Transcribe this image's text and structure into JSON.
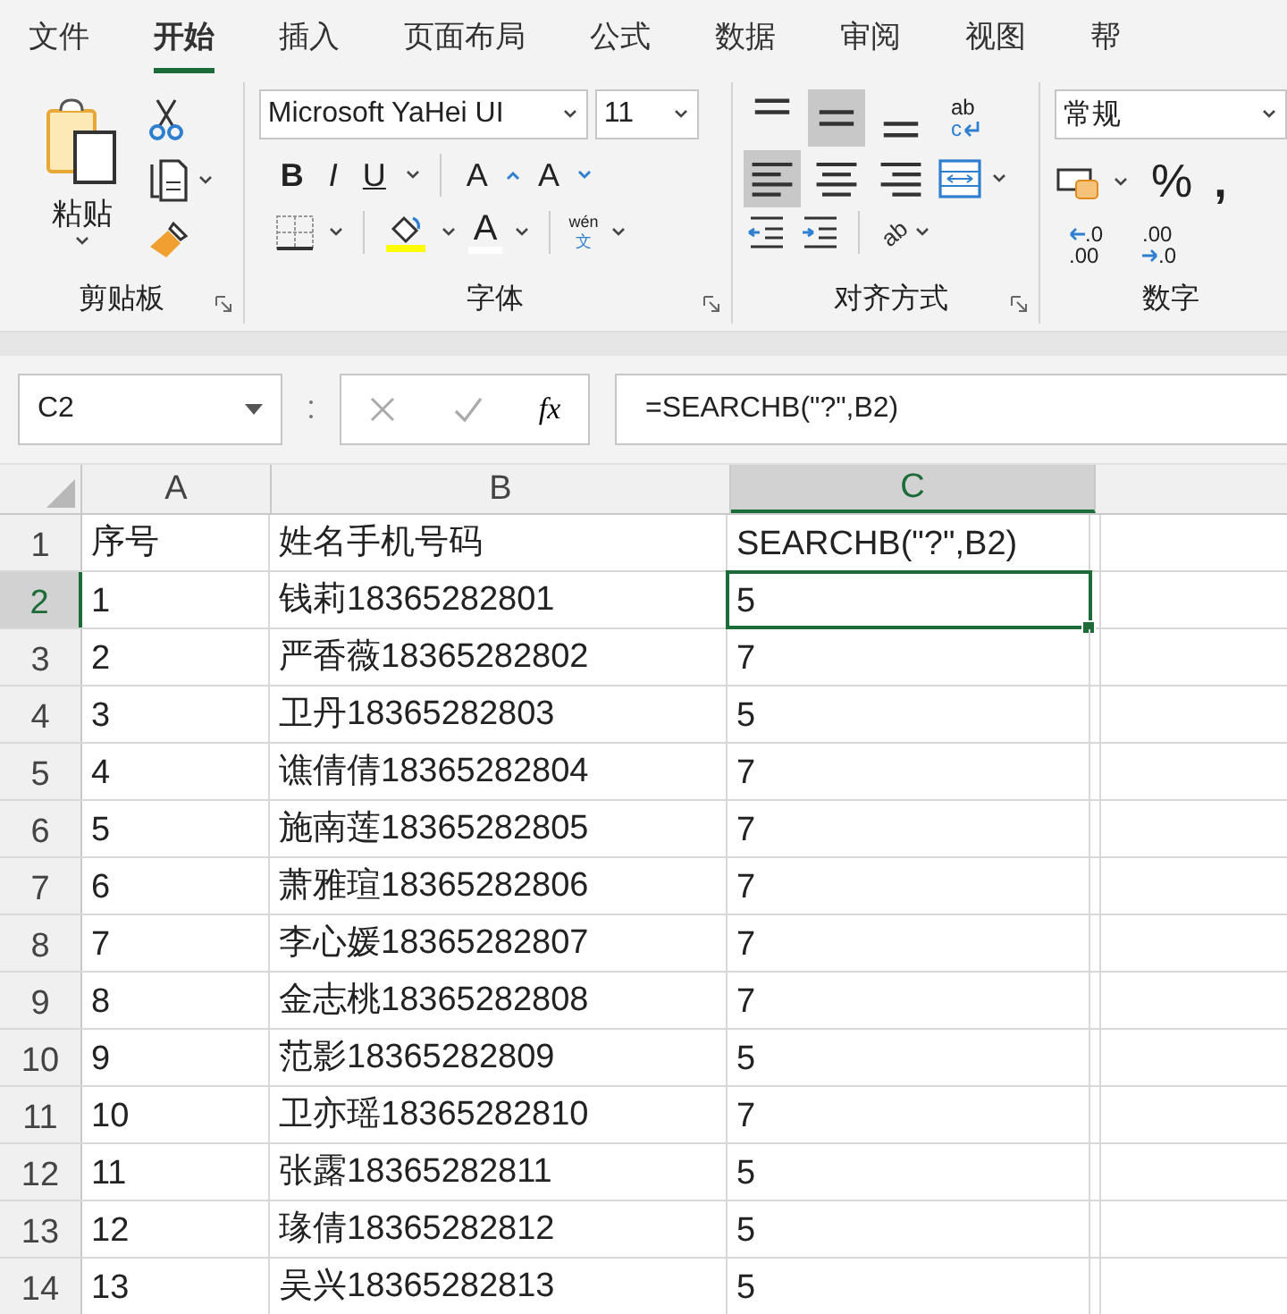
{
  "ribbon_tabs": [
    {
      "label": "文件",
      "selected": false
    },
    {
      "label": "开始",
      "selected": true
    },
    {
      "label": "插入",
      "selected": false
    },
    {
      "label": "页面布局",
      "selected": false
    },
    {
      "label": "公式",
      "selected": false
    },
    {
      "label": "数据",
      "selected": false
    },
    {
      "label": "审阅",
      "selected": false
    },
    {
      "label": "视图",
      "selected": false
    },
    {
      "label": "帮",
      "selected": false
    }
  ],
  "clipboard": {
    "paste_label": "粘贴",
    "group_label": "剪贴板"
  },
  "font": {
    "family": "Microsoft YaHei UI",
    "size": "11",
    "bold": "B",
    "italic": "I",
    "underline": "U",
    "grow": "A",
    "shrink": "A",
    "font_color": "A",
    "phonetic_top": "wén",
    "phonetic_bottom": "文",
    "group_label": "字体"
  },
  "alignment": {
    "vertical": [
      {
        "kind": "top",
        "selected": false
      },
      {
        "kind": "middle",
        "selected": true
      },
      {
        "kind": "bottom",
        "selected": false
      }
    ],
    "horizontal": [
      {
        "kind": "left",
        "selected": true
      },
      {
        "kind": "center",
        "selected": false
      },
      {
        "kind": "right",
        "selected": false
      }
    ],
    "wrap_top": "ab",
    "wrap_bottom": "c",
    "orientation": "ab",
    "group_label": "对齐方式"
  },
  "number": {
    "format": "常规",
    "percent": "%",
    "comma": ",",
    "increase_decimal": [
      ".0",
      ".00"
    ],
    "decrease_decimal": [
      ".00",
      ".0"
    ],
    "group_label": "数字"
  },
  "formula_bar": {
    "name_box": "C2",
    "fx": "fx",
    "formula": "=SEARCHB(\"?\",B2)"
  },
  "columns": [
    {
      "label": "A",
      "selected": false
    },
    {
      "label": "B",
      "selected": false
    },
    {
      "label": "C",
      "selected": true
    }
  ],
  "rows": [
    {
      "number": "1",
      "selected": false,
      "cells": [
        {
          "text": "序号",
          "selected": false
        },
        {
          "text": "姓名手机号码",
          "selected": false
        },
        {
          "text": "SEARCHB(\"?\",B2)",
          "selected": false
        }
      ]
    },
    {
      "number": "2",
      "selected": true,
      "cells": [
        {
          "text": "1",
          "selected": false
        },
        {
          "text": "钱莉18365282801",
          "selected": false
        },
        {
          "text": "5",
          "selected": true
        }
      ]
    },
    {
      "number": "3",
      "selected": false,
      "cells": [
        {
          "text": "2",
          "selected": false
        },
        {
          "text": "严香薇18365282802",
          "selected": false
        },
        {
          "text": "7",
          "selected": false
        }
      ]
    },
    {
      "number": "4",
      "selected": false,
      "cells": [
        {
          "text": "3",
          "selected": false
        },
        {
          "text": "卫丹18365282803",
          "selected": false
        },
        {
          "text": "5",
          "selected": false
        }
      ]
    },
    {
      "number": "5",
      "selected": false,
      "cells": [
        {
          "text": "4",
          "selected": false
        },
        {
          "text": "谯倩倩18365282804",
          "selected": false
        },
        {
          "text": "7",
          "selected": false
        }
      ]
    },
    {
      "number": "6",
      "selected": false,
      "cells": [
        {
          "text": "5",
          "selected": false
        },
        {
          "text": "施南莲18365282805",
          "selected": false
        },
        {
          "text": "7",
          "selected": false
        }
      ]
    },
    {
      "number": "7",
      "selected": false,
      "cells": [
        {
          "text": "6",
          "selected": false
        },
        {
          "text": "萧雅瑄18365282806",
          "selected": false
        },
        {
          "text": "7",
          "selected": false
        }
      ]
    },
    {
      "number": "8",
      "selected": false,
      "cells": [
        {
          "text": "7",
          "selected": false
        },
        {
          "text": "李心媛18365282807",
          "selected": false
        },
        {
          "text": "7",
          "selected": false
        }
      ]
    },
    {
      "number": "9",
      "selected": false,
      "cells": [
        {
          "text": "8",
          "selected": false
        },
        {
          "text": "金志桃18365282808",
          "selected": false
        },
        {
          "text": "7",
          "selected": false
        }
      ]
    },
    {
      "number": "10",
      "selected": false,
      "cells": [
        {
          "text": "9",
          "selected": false
        },
        {
          "text": "范影18365282809",
          "selected": false
        },
        {
          "text": "5",
          "selected": false
        }
      ]
    },
    {
      "number": "11",
      "selected": false,
      "cells": [
        {
          "text": "10",
          "selected": false
        },
        {
          "text": "卫亦瑶18365282810",
          "selected": false
        },
        {
          "text": "7",
          "selected": false
        }
      ]
    },
    {
      "number": "12",
      "selected": false,
      "cells": [
        {
          "text": "11",
          "selected": false
        },
        {
          "text": "张露18365282811",
          "selected": false
        },
        {
          "text": "5",
          "selected": false
        }
      ]
    },
    {
      "number": "13",
      "selected": false,
      "cells": [
        {
          "text": "12",
          "selected": false
        },
        {
          "text": "瑑倩18365282812",
          "selected": false
        },
        {
          "text": "5",
          "selected": false
        }
      ]
    },
    {
      "number": "14",
      "selected": false,
      "cells": [
        {
          "text": "13",
          "selected": false
        },
        {
          "text": "吴兴18365282813",
          "selected": false
        },
        {
          "text": "5",
          "selected": false
        }
      ]
    }
  ]
}
